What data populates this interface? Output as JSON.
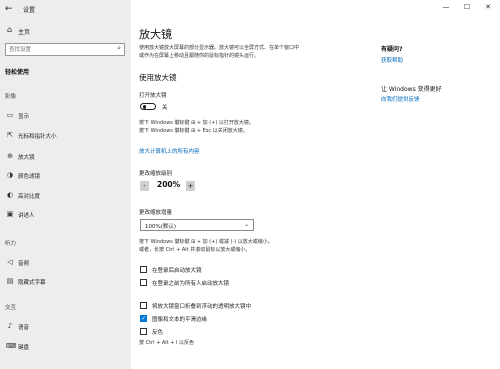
{
  "window": {
    "title": "设置",
    "controls": [
      "—",
      "☐",
      "✕"
    ]
  },
  "sidebar": {
    "home": "主页",
    "search_placeholder": "查找设置",
    "category": "轻松使用",
    "groups": [
      {
        "label": "影像",
        "items": [
          {
            "label": "显示",
            "icon": "monitor-icon"
          },
          {
            "label": "光标和指针大小",
            "icon": "cursor-icon"
          },
          {
            "label": "放大镜",
            "icon": "magnifier-icon"
          },
          {
            "label": "颜色滤镜",
            "icon": "color-filter-icon"
          },
          {
            "label": "高对比度",
            "icon": "contrast-icon"
          },
          {
            "label": "讲述人",
            "icon": "narrator-icon"
          }
        ]
      },
      {
        "label": "听力",
        "items": [
          {
            "label": "音频",
            "icon": "speaker-icon"
          },
          {
            "label": "隐藏式字幕",
            "icon": "captions-icon"
          }
        ]
      },
      {
        "label": "交互",
        "items": [
          {
            "label": "语音",
            "icon": "microphone-icon"
          },
          {
            "label": "键盘",
            "icon": "keyboard-icon"
          }
        ]
      }
    ]
  },
  "main": {
    "title": "放大镜",
    "description": [
      "使用放大镜放大屏幕的部分显示器。放大镜可以全屏方式、在单个窗口中",
      "或作为在屏幕上移动且跟随你的鼠标指针的镜头运行。"
    ],
    "use_heading": "使用放大镜",
    "toggle_label": "打开放大镜",
    "toggle_state": "关",
    "toggle_on": false,
    "shortcuts_on_off": [
      "按下 Windows 徽标键 ⊞ + 加 (+) 以打开放大镜。",
      "按下 Windows 徽标键 ⊞ + Esc 以关闭放大镜。"
    ],
    "zoom_link": "放大计算机上的所有内容",
    "zoom_level_label": "更改缩放级别",
    "zoom_minus": "-",
    "zoom_value": "200%",
    "zoom_plus": "+",
    "increment_label": "更改缩放增量",
    "increment_value": "100%(默认)",
    "shortcuts_zoom": [
      "按下 Windows 徽标键 ⊞ + 加 (+) 或减 (-) 以放大或缩小。",
      "或者，长按 Ctrl + Alt 并滚动鼠标以放大或缩小。"
    ],
    "checkboxes_a": [
      {
        "label": "在登录后启动放大镜",
        "checked": false
      },
      {
        "label": "在登录之前为所有人启动放大镜",
        "checked": false
      }
    ],
    "checkboxes_b": [
      {
        "label": "将放大镜窗口折叠到浮动的透明放大镜中",
        "checked": false
      },
      {
        "label": "图像和文本的平滑边缘",
        "checked": true
      },
      {
        "label": "反色",
        "checked": false
      }
    ],
    "invert_hint": "按 Ctrl + Alt + I 以反色"
  },
  "right_column": {
    "question_title": "有疑问?",
    "get_help": "获取帮助",
    "improve_title": "让 Windows 变得更好",
    "feedback": "向我们提供反馈"
  },
  "colors": {
    "accent": "#0078d7",
    "link": "#0067b8",
    "sidebar_bg": "#ededed"
  }
}
